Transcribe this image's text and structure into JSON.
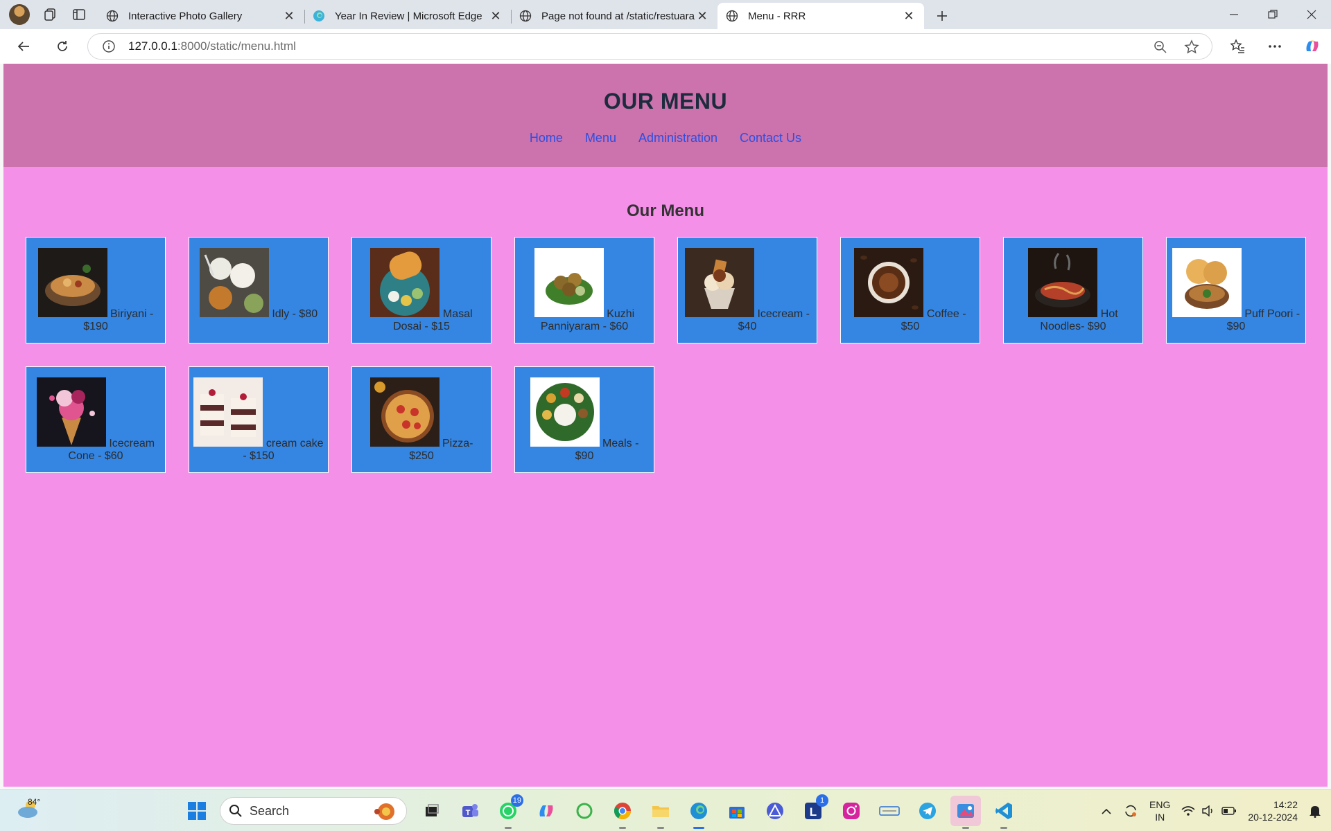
{
  "browser": {
    "tabs": [
      {
        "title": "Interactive Photo Gallery",
        "active": false
      },
      {
        "title": "Year In Review | Microsoft Edge",
        "active": false
      },
      {
        "title": "Page not found at /static/restuarant",
        "active": false
      },
      {
        "title": "Menu - RRR",
        "active": true
      }
    ],
    "url_host": "127.0.0.1",
    "url_rest": ":8000/static/menu.html"
  },
  "page": {
    "header_title": "OUR MENU",
    "nav": [
      "Home",
      "Menu",
      "Administration",
      "Contact Us"
    ],
    "section_title": "Our Menu",
    "items": [
      {
        "label": "Biriyani - $190",
        "image": "biriyani"
      },
      {
        "label": "Idly - $80",
        "image": "idly"
      },
      {
        "label": "Masal Dosai - $15",
        "image": "dosai"
      },
      {
        "label": "Kuzhi Panniyaram - $60",
        "image": "panniyaram"
      },
      {
        "label": "Icecream - $40",
        "image": "icecream"
      },
      {
        "label": "Coffee - $50",
        "image": "coffee"
      },
      {
        "label": "Hot Noodles- $90",
        "image": "noodles"
      },
      {
        "label": "Puff Poori - $90",
        "image": "poori"
      },
      {
        "label": "Icecream Cone - $60",
        "image": "cone"
      },
      {
        "label": "cream cake - $150",
        "image": "cake"
      },
      {
        "label": "Pizza- $250",
        "image": "pizza"
      },
      {
        "label": "Meals - $90",
        "image": "meals"
      }
    ]
  },
  "taskbar": {
    "weather_temp": "84°",
    "search_placeholder": "Search",
    "whatsapp_badge": "19",
    "l_app_badge": "1",
    "lang_line1": "ENG",
    "lang_line2": "IN",
    "time": "14:22",
    "date": "20-12-2024"
  }
}
